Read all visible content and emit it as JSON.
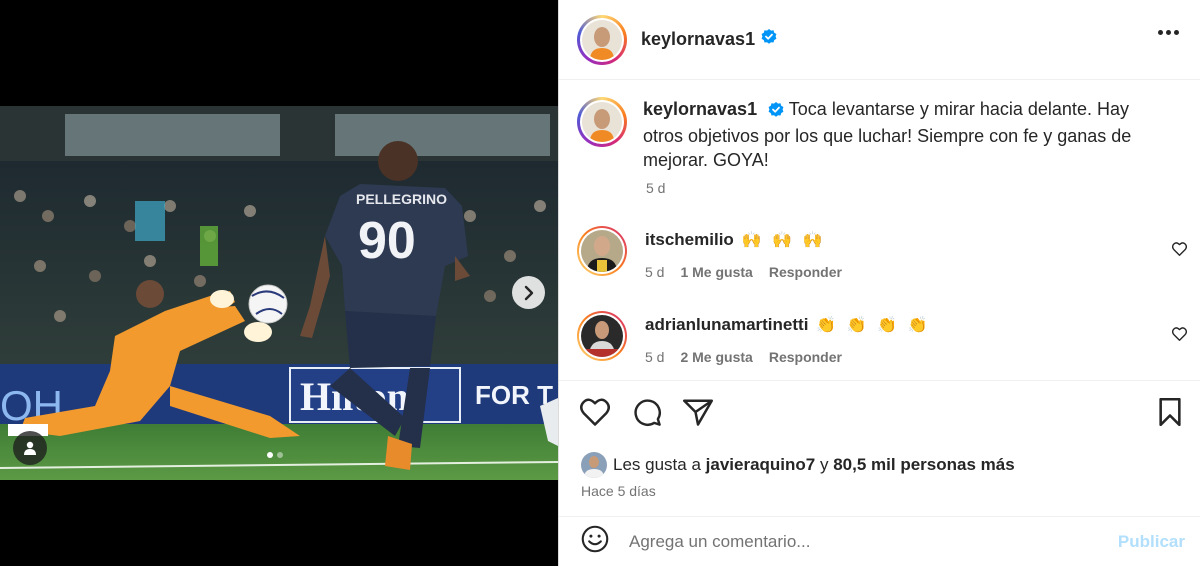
{
  "colors": {
    "accent": "#0095f6",
    "verified": "#0095f6",
    "disabled_post": "#b2dffc",
    "muted": "#737373"
  },
  "header": {
    "username": "keylornavas1",
    "verified": true,
    "more_icon": "more-horizontal-icon"
  },
  "media": {
    "jersey_name": "PELLEGRINO",
    "jersey_number": "90",
    "banner_left": "OH",
    "banner_mid": "Hilton",
    "banner_right": "FOR T",
    "slide_count": 2,
    "active_slide": 1,
    "next_icon": "chevron-right-icon",
    "tag_icon": "user-tag-icon"
  },
  "caption": {
    "username": "keylornavas1",
    "text": "Toca levantarse y mirar hacia delante. Hay otros objetivos por los que luchar! Siempre con fe y ganas de mejorar. GOYA!",
    "time": "5 d"
  },
  "comments": [
    {
      "username": "itschemilio",
      "text": "🙌 🙌 🙌",
      "time": "5 d",
      "likes": "1 Me gusta",
      "reply": "Responder"
    },
    {
      "username": "adrianlunamartinetti",
      "text": "👏 👏 👏 👏",
      "time": "5 d",
      "likes": "2 Me gusta",
      "reply": "Responder"
    }
  ],
  "actions": {
    "like_icon": "heart-icon",
    "comment_icon": "comment-icon",
    "share_icon": "send-icon",
    "save_icon": "bookmark-icon"
  },
  "likes": {
    "prefix": "Les gusta a",
    "user": "javieraquino7",
    "connector": "y",
    "others": "80,5 mil personas más"
  },
  "timestamp": "Hace 5 días",
  "add_comment": {
    "placeholder": "Agrega un comentario...",
    "post_label": "Publicar",
    "emoji_icon": "emoji-icon"
  }
}
